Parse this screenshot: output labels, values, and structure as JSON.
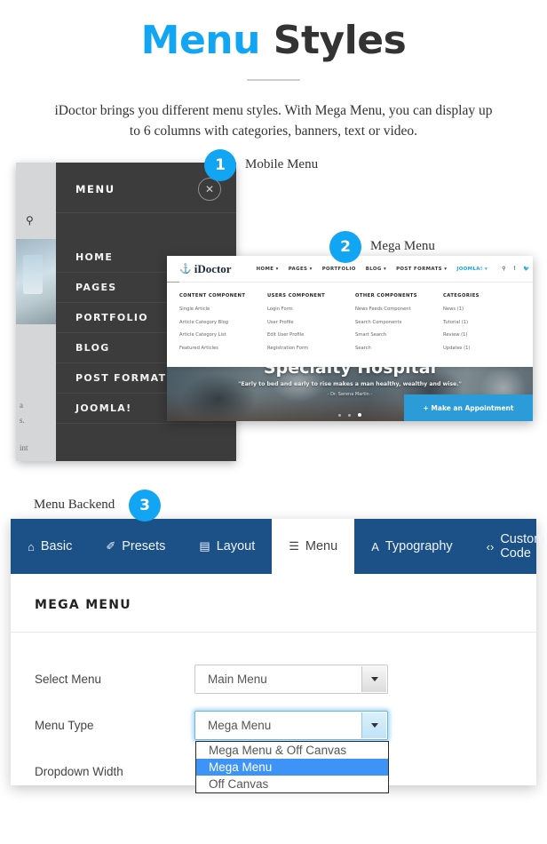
{
  "header": {
    "title_blue": "Menu",
    "title_dark": "Styles",
    "subtitle": "iDoctor brings you different menu styles. With Mega Menu, you can display up to 6 columns with categories, banners, text or video."
  },
  "callouts": [
    {
      "number": "1",
      "label": "Mobile Menu"
    },
    {
      "number": "2",
      "label": "Mega Menu"
    },
    {
      "number": "3",
      "label": "Menu Backend"
    }
  ],
  "mobile_menu": {
    "title": "MENU",
    "close_icon": "close-icon",
    "search_icon": "search-icon",
    "items": [
      "HOME",
      "PAGES",
      "PORTFOLIO",
      "BLOG",
      "POST FORMATS",
      "JOOMLA!"
    ],
    "edge_text": [
      "a",
      "s.",
      "int"
    ]
  },
  "mega_menu": {
    "logo": "iDoctor",
    "nav": [
      {
        "label": "HOME ▾",
        "active": false
      },
      {
        "label": "PAGES ▾",
        "active": false
      },
      {
        "label": "PORTFOLIO",
        "active": false
      },
      {
        "label": "BLOG ▾",
        "active": false
      },
      {
        "label": "POST FORMATS ▾",
        "active": false
      },
      {
        "label": "JOOMLA! ▾",
        "active": true
      }
    ],
    "icons": [
      "search-icon",
      "facebook-icon",
      "twitter-icon",
      "google-plus-icon"
    ],
    "columns": [
      {
        "heading": "CONTENT COMPONENT",
        "items": [
          "Single Article",
          "Article Category Blog",
          "Article Category List",
          "Featured Articles"
        ]
      },
      {
        "heading": "USERS COMPONENT",
        "items": [
          "Login Form",
          "User Profile",
          "Edit User Profile",
          "Registration Form"
        ]
      },
      {
        "heading": "OTHER COMPONENTS",
        "items": [
          "News Feeds Component",
          "Search Components",
          "Smart Search",
          "Search"
        ]
      },
      {
        "heading": "CATEGORIES",
        "items": [
          "News (1)",
          "Tutorial (1)",
          "Review (1)",
          "Updates (1)"
        ]
      }
    ],
    "hero": {
      "title": "Specialty Hospital",
      "quote": "\"Early to bed and early to rise makes a man healthy, wealthy and wise.\"",
      "author": "- Dr. Serena Martin -",
      "cta": "+ Make an Appointment"
    }
  },
  "backend": {
    "tabs": [
      {
        "label": "Basic",
        "icon": "home-icon",
        "glyph": "⌂",
        "active": false
      },
      {
        "label": "Presets",
        "icon": "brush-icon",
        "glyph": "✐",
        "active": false
      },
      {
        "label": "Layout",
        "icon": "layout-icon",
        "glyph": "▤",
        "active": false
      },
      {
        "label": "Menu",
        "icon": "list-icon",
        "glyph": "☰",
        "active": true
      },
      {
        "label": "Typography",
        "icon": "typography-icon",
        "glyph": "A",
        "active": false
      },
      {
        "label": "Custom Code",
        "icon": "code-icon",
        "glyph": "‹›",
        "active": false
      }
    ],
    "section_title": "MEGA MENU",
    "fields": [
      {
        "label": "Select Menu",
        "value": "Main Menu",
        "focused": false
      },
      {
        "label": "Menu Type",
        "value": "Mega Menu",
        "focused": true
      },
      {
        "label": "Dropdown Width",
        "value": "",
        "focused": false
      }
    ],
    "menu_type_options": [
      {
        "label": "Mega Menu & Off Canvas",
        "selected": false
      },
      {
        "label": "Mega Menu",
        "selected": true
      },
      {
        "label": "Off Canvas",
        "selected": false
      }
    ]
  },
  "colors": {
    "accent_blue": "#12A5F4",
    "panel_navy": "#1C5188",
    "cta_blue": "#2B9CD8",
    "option_highlight": "#3D94F6",
    "dark_panel": "#3C3C3C"
  }
}
